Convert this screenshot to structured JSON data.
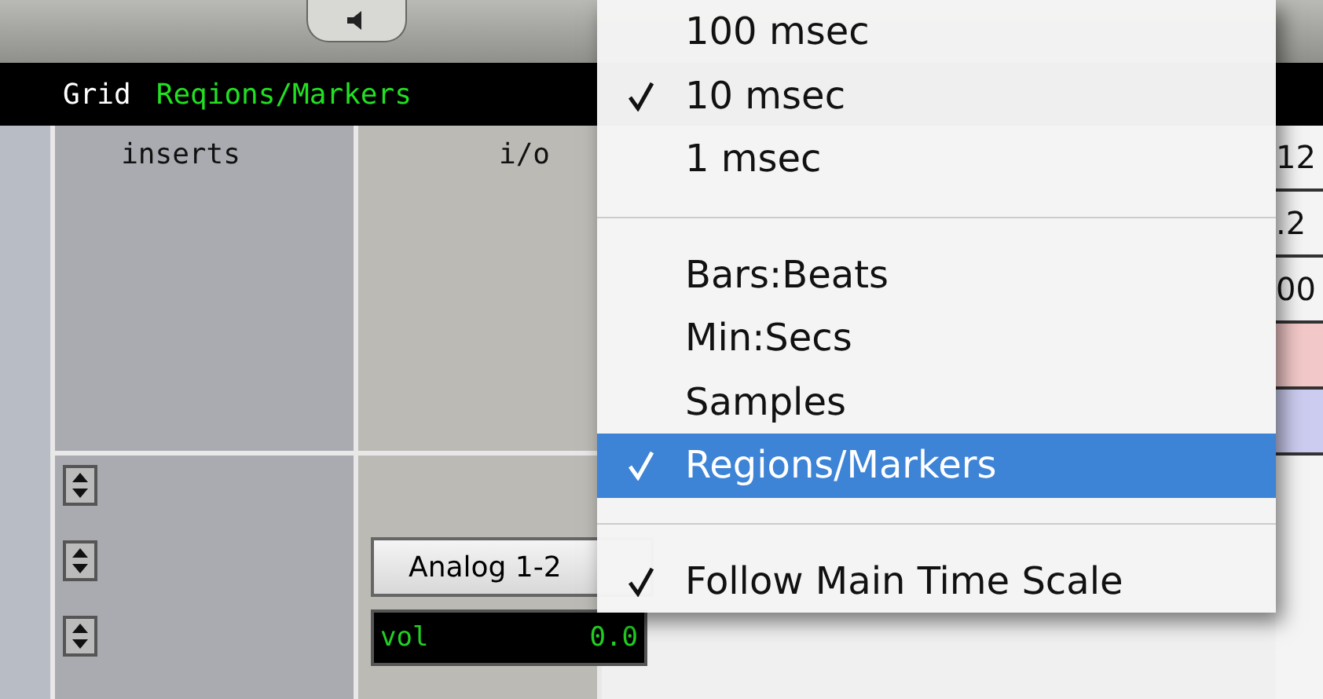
{
  "grid_bar": {
    "label": "Grid",
    "value": "Reqions/Markers"
  },
  "columns": [
    {
      "title": "inserts"
    },
    {
      "title": "i/o"
    }
  ],
  "output_button": {
    "label": "Analog 1-2"
  },
  "volume": {
    "label": "vol",
    "value": "0.0"
  },
  "right_cells": [
    "12",
    ".2",
    "00"
  ],
  "menu": {
    "items": [
      {
        "kind": "item",
        "label": "100 msec",
        "checked": false,
        "selected": false
      },
      {
        "kind": "item",
        "label": "10 msec",
        "checked": true,
        "selected": false
      },
      {
        "kind": "item",
        "label": "1 msec",
        "checked": false,
        "selected": false
      },
      {
        "kind": "separator"
      },
      {
        "kind": "item",
        "label": "Bars:Beats",
        "checked": false,
        "selected": false
      },
      {
        "kind": "item",
        "label": "Min:Secs",
        "checked": false,
        "selected": false
      },
      {
        "kind": "item",
        "label": "Samples",
        "checked": false,
        "selected": false
      },
      {
        "kind": "item",
        "label": "Regions/Markers",
        "checked": true,
        "selected": true
      },
      {
        "kind": "separator"
      },
      {
        "kind": "item",
        "label": "Follow Main Time Scale",
        "checked": true,
        "selected": false
      }
    ]
  }
}
